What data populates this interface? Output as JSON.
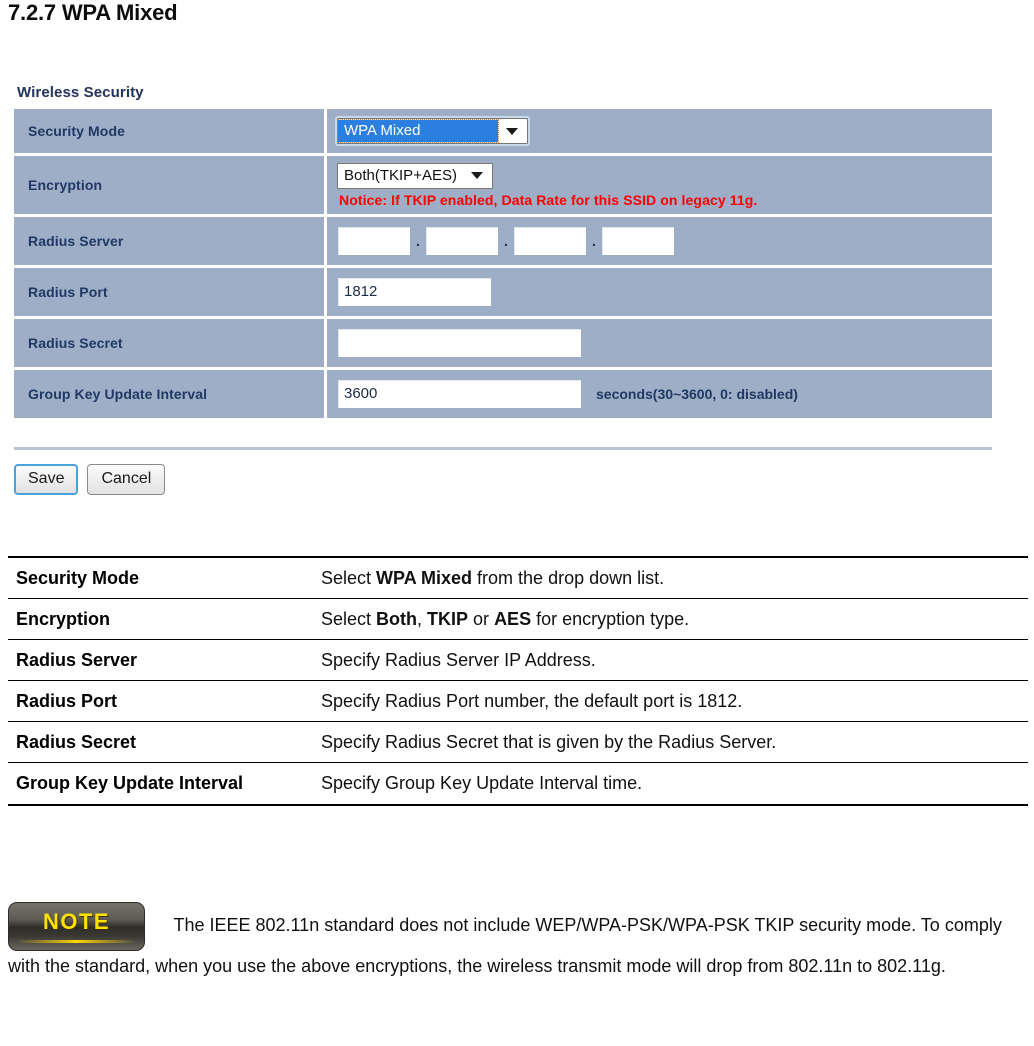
{
  "page": {
    "title": "7.2.7 WPA Mixed"
  },
  "config_panel": {
    "heading": "Wireless Security",
    "rows": {
      "security_mode": {
        "label": "Security Mode",
        "value": "WPA Mixed"
      },
      "encryption": {
        "label": "Encryption",
        "value": "Both(TKIP+AES)",
        "notice": "Notice: If TKIP enabled, Data Rate for this SSID on legacy 11g."
      },
      "radius_server": {
        "label": "Radius Server",
        "octets": [
          "",
          "",
          "",
          ""
        ],
        "separator": "."
      },
      "radius_port": {
        "label": "Radius Port",
        "value": "1812"
      },
      "radius_secret": {
        "label": "Radius Secret",
        "value": ""
      },
      "group_key_update_interval": {
        "label": "Group Key Update Interval",
        "value": "3600",
        "unit": "seconds(30~3600, 0: disabled)"
      }
    },
    "buttons": {
      "save": "Save",
      "cancel": "Cancel"
    },
    "colors": {
      "row_background": "#9eaec6",
      "label_text": "#203864",
      "notice_text": "#ff0000",
      "selection_highlight": "#2a7fe0"
    }
  },
  "description_table": {
    "rows": [
      {
        "key": "Security Mode",
        "parts": [
          {
            "text": "Select ",
            "bold": false
          },
          {
            "text": "WPA Mixed",
            "bold": true
          },
          {
            "text": " from the drop down list.",
            "bold": false
          }
        ]
      },
      {
        "key": "Encryption",
        "parts": [
          {
            "text": "Select ",
            "bold": false
          },
          {
            "text": "Both",
            "bold": true
          },
          {
            "text": ", ",
            "bold": false
          },
          {
            "text": "TKIP",
            "bold": true
          },
          {
            "text": " or ",
            "bold": false
          },
          {
            "text": "AES",
            "bold": true
          },
          {
            "text": " for encryption type.",
            "bold": false
          }
        ]
      },
      {
        "key": "Radius Server",
        "parts": [
          {
            "text": "Specify Radius Server IP Address.",
            "bold": false
          }
        ]
      },
      {
        "key": "Radius Port",
        "parts": [
          {
            "text": "Specify Radius Port number, the default port is 1812.",
            "bold": false
          }
        ]
      },
      {
        "key": "Radius Secret",
        "parts": [
          {
            "text": "Specify Radius Secret that is given by the Radius Server.",
            "bold": false
          }
        ]
      },
      {
        "key": "Group Key Update Interval",
        "parts": [
          {
            "text": "Specify Group Key Update Interval time.",
            "bold": false
          }
        ]
      }
    ]
  },
  "note": {
    "badge_label": "NOTE",
    "text": "The IEEE 802.11n standard does not include WEP/WPA-PSK/WPA-PSK TKIP security mode. To comply with the standard, when you use the above encryptions, the wireless transmit mode will drop from 802.11n to 802.11g."
  }
}
